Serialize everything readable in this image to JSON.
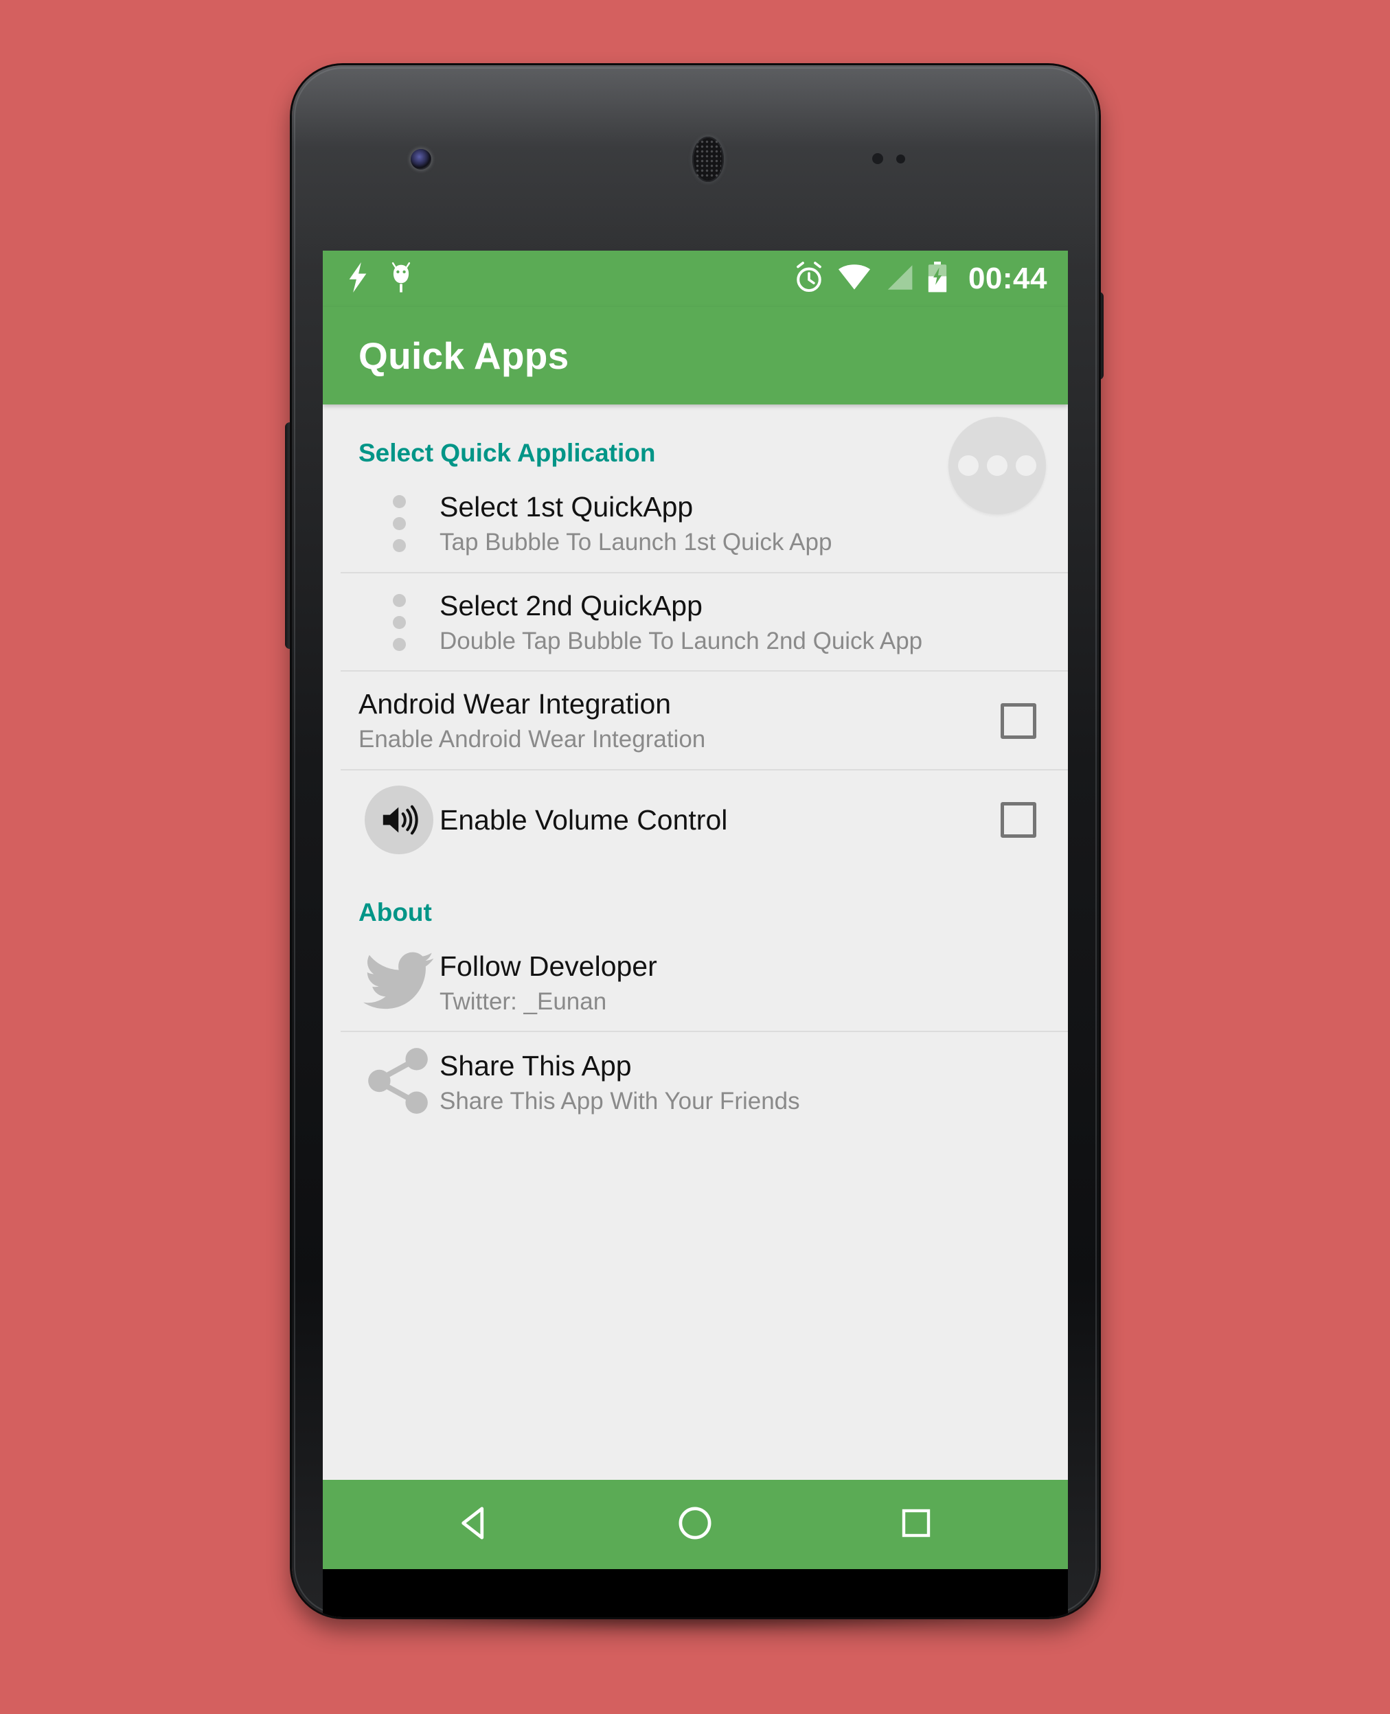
{
  "theme": {
    "background": "#d4605f",
    "accent_green": "#5bab55",
    "section_header_teal": "#009587",
    "list_background": "#eeeeee",
    "title_text": "#121212",
    "summary_text": "#8a8a8a"
  },
  "status_bar": {
    "time": "00:44",
    "left_icons": [
      "lightning-bolt-icon",
      "android-debug-icon"
    ],
    "right_icons": [
      "alarm-clock-icon",
      "wifi-icon",
      "cell-signal-icon",
      "battery-charging-icon"
    ]
  },
  "app_bar": {
    "title": "Quick Apps"
  },
  "floating_bubble": {
    "icon": "three-dots-bubble-icon"
  },
  "sections": [
    {
      "header": "Select Quick Application",
      "rows": [
        {
          "icon": "three-dots-vertical-icon",
          "title": "Select 1st QuickApp",
          "summary": "Tap Bubble To Launch 1st Quick App",
          "accessory": "none"
        },
        {
          "icon": "three-dots-vertical-icon",
          "title": "Select 2nd QuickApp",
          "summary": "Double Tap Bubble To Launch 2nd Quick App",
          "accessory": "none"
        },
        {
          "icon": "none",
          "title": "Android Wear Integration",
          "summary": "Enable Android Wear Integration",
          "accessory": "checkbox",
          "checked": false
        },
        {
          "icon": "volume-speaker-icon",
          "title": "Enable Volume Control",
          "summary": "",
          "accessory": "checkbox",
          "checked": false
        }
      ]
    },
    {
      "header": "About",
      "rows": [
        {
          "icon": "twitter-bird-icon",
          "title": "Follow Developer",
          "summary": "Twitter: _Eunan",
          "accessory": "none"
        },
        {
          "icon": "share-nodes-icon",
          "title": "Share This App",
          "summary": "Share This App With Your Friends",
          "accessory": "none"
        }
      ]
    }
  ],
  "nav_bar": {
    "buttons": [
      {
        "name": "back",
        "icon": "back-triangle-icon"
      },
      {
        "name": "home",
        "icon": "home-circle-icon"
      },
      {
        "name": "recents",
        "icon": "recents-square-icon"
      }
    ]
  }
}
